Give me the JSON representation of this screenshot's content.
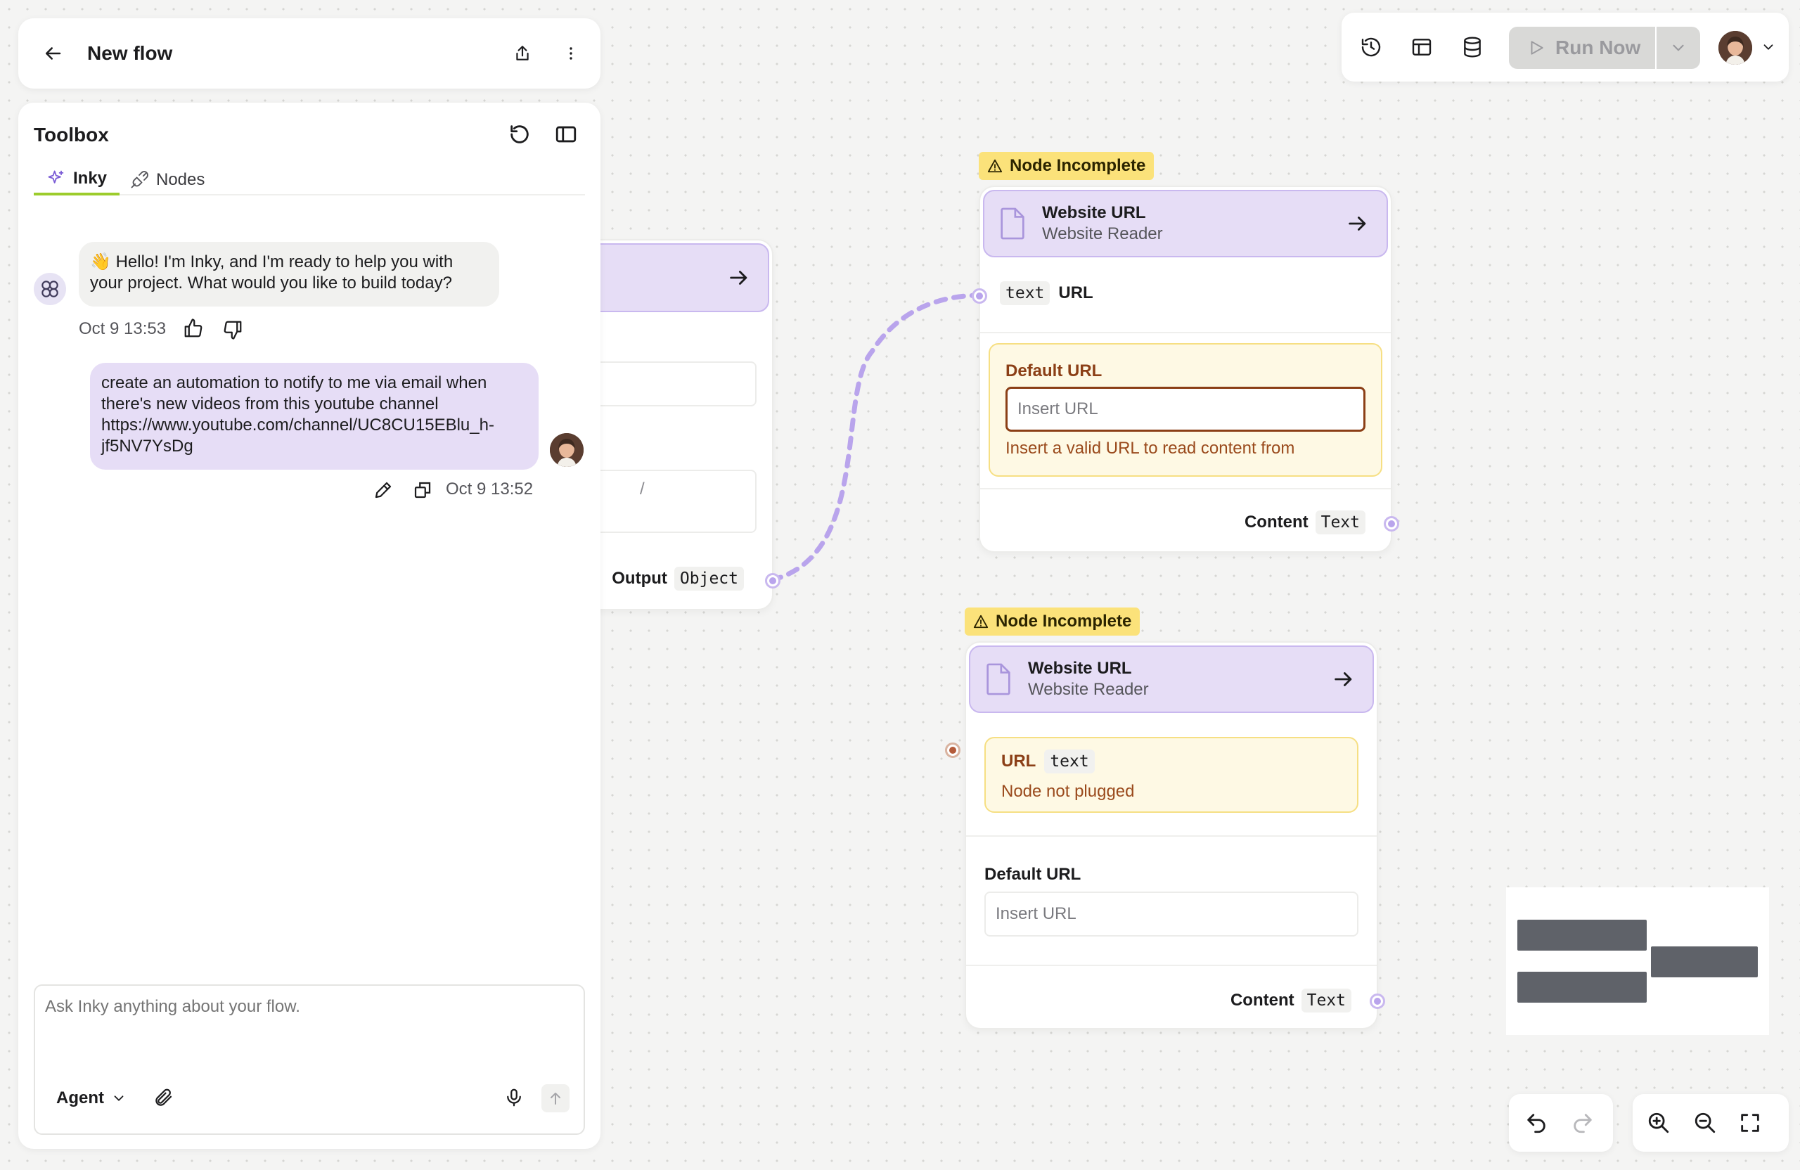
{
  "header": {
    "title": "New flow"
  },
  "toolbar": {
    "run_label": "Run Now"
  },
  "toolbox": {
    "title": "Toolbox",
    "tabs": [
      {
        "label": "Inky",
        "active": true
      },
      {
        "label": "Nodes",
        "active": false
      }
    ],
    "messages": {
      "assistant": {
        "text": "Hello! I'm Inky, and I'm ready to help you with your project. What would you like to build today?",
        "emoji": "👋",
        "time": "Oct 9 13:53"
      },
      "user": {
        "text": "create an automation to notify to me via email when there's new videos from this youtube channel https://www.youtube.com/channel/UC8CU15EBlu_h-jf5NV7YsDg",
        "time": "Oct 9 13:52"
      }
    },
    "composer": {
      "placeholder": "Ask Inky anything about your flow.",
      "mode_label": "Agent"
    }
  },
  "partial_node": {
    "output_label": "Output",
    "output_type": "Object",
    "input_fragment": "/"
  },
  "node1": {
    "badge": "Node Incomplete",
    "title": "Website URL",
    "subtitle": "Website Reader",
    "input_type": "text",
    "input_label": "URL",
    "default_label": "Default URL",
    "placeholder": "Insert URL",
    "error": "Insert a valid URL to read content from",
    "output_label": "Content",
    "output_type": "Text"
  },
  "node2": {
    "badge": "Node Incomplete",
    "title": "Website URL",
    "subtitle": "Website Reader",
    "input_label": "URL",
    "input_type": "text",
    "warning": "Node not plugged",
    "default_label": "Default URL",
    "placeholder": "Insert URL",
    "output_label": "Content",
    "output_type": "Text"
  },
  "colors": {
    "accent": "#c9b8ef",
    "node_header": "#e6ddf6",
    "badge": "#fbe27a",
    "active_tab_underline": "#9ccc2c",
    "error_text": "#9a4a1c"
  }
}
